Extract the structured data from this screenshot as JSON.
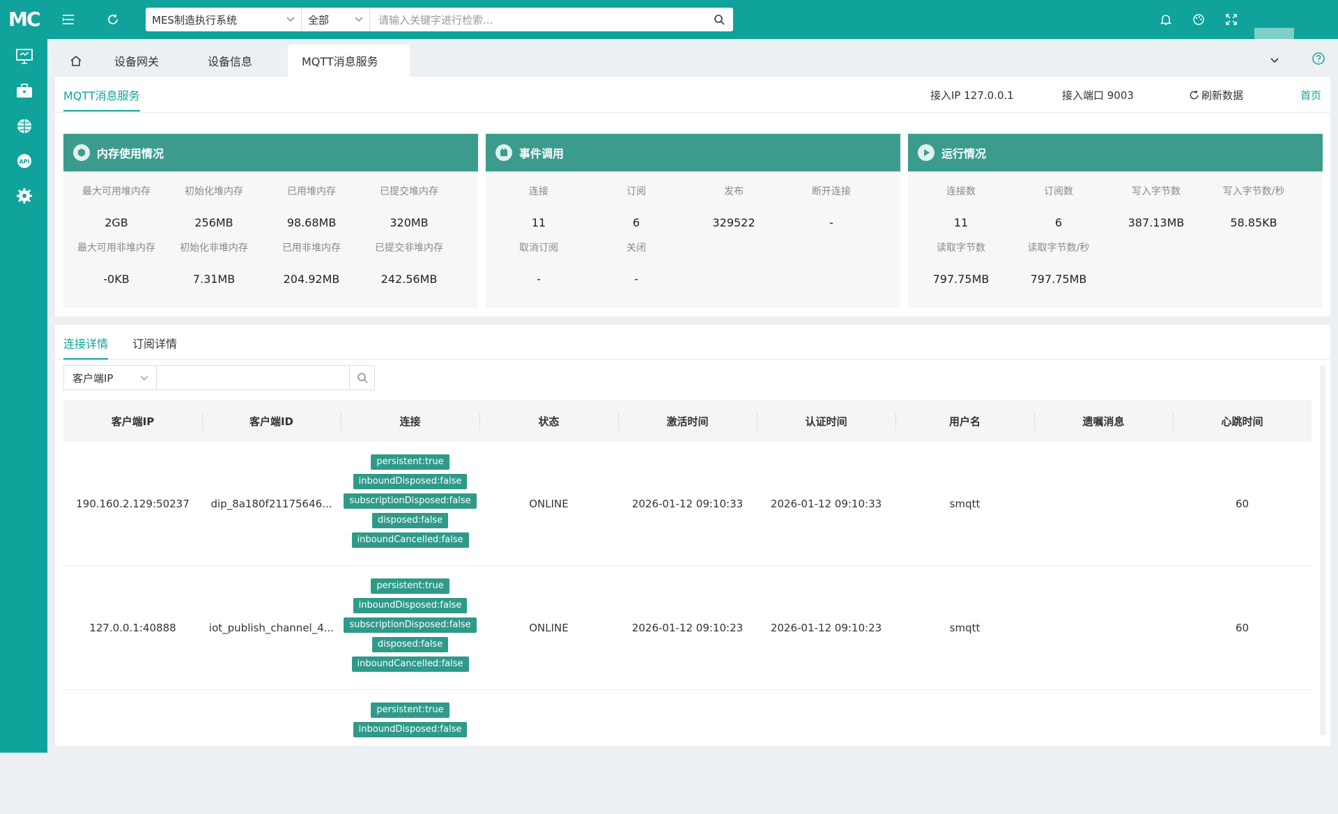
{
  "app": {
    "logo": "MC",
    "system_select": "MES制造执行系统",
    "scope_select": "全部",
    "search_placeholder": "请输入关键字进行检索..."
  },
  "tabs": [
    {
      "label": "设备网关"
    },
    {
      "label": "设备信息"
    },
    {
      "label": "MQTT消息服务"
    }
  ],
  "header": {
    "title": "MQTT消息服务",
    "ip": "接入IP 127.0.0.1",
    "port": "接入端口 9003",
    "refresh": "刷新数据",
    "home": "首页"
  },
  "cards": {
    "memory": {
      "title": "内存使用情况",
      "items": [
        {
          "label": "最大可用堆内存",
          "value": "2GB"
        },
        {
          "label": "初始化堆内存",
          "value": "256MB"
        },
        {
          "label": "已用堆内存",
          "value": "98.68MB"
        },
        {
          "label": "已提交堆内存",
          "value": "320MB"
        },
        {
          "label": "最大可用非堆内存",
          "value": "-0KB"
        },
        {
          "label": "初始化非堆内存",
          "value": "7.31MB"
        },
        {
          "label": "已用非堆内存",
          "value": "204.92MB"
        },
        {
          "label": "已提交非堆内存",
          "value": "242.56MB"
        }
      ]
    },
    "events": {
      "title": "事件调用",
      "items": [
        {
          "label": "连接",
          "value": "11"
        },
        {
          "label": "订阅",
          "value": "6"
        },
        {
          "label": "发布",
          "value": "329522"
        },
        {
          "label": "断开连接",
          "value": "-"
        },
        {
          "label": "取消订阅",
          "value": "-"
        },
        {
          "label": "关闭",
          "value": "-"
        }
      ]
    },
    "runtime": {
      "title": "运行情况",
      "items": [
        {
          "label": "连接数",
          "value": "11"
        },
        {
          "label": "订阅数",
          "value": "6"
        },
        {
          "label": "写入字节数",
          "value": "387.13MB"
        },
        {
          "label": "写入字节数/秒",
          "value": "58.85KB"
        },
        {
          "label": "读取字节数",
          "value": "797.75MB"
        },
        {
          "label": "读取字节数/秒",
          "value": "797.75MB"
        }
      ]
    }
  },
  "subtabs": {
    "connections": "连接详情",
    "subscriptions": "订阅详情"
  },
  "filter": {
    "field": "客户端IP"
  },
  "table": {
    "columns": [
      "客户端IP",
      "客户端ID",
      "连接",
      "状态",
      "激活时间",
      "认证时间",
      "用户名",
      "遗嘱消息",
      "心跳时间"
    ],
    "rows": [
      {
        "ip": "190.160.2.129:50237",
        "client_id": "dip_8a180f21175646...",
        "tags": [
          "persistent:true",
          "inboundDisposed:false",
          "subscriptionDisposed:false",
          "disposed:false",
          "inboundCancelled:false"
        ],
        "status": "ONLINE",
        "active_time": "2026-01-12 09:10:33",
        "auth_time": "2026-01-12 09:10:33",
        "username": "smqtt",
        "will": "",
        "heartbeat": "60"
      },
      {
        "ip": "127.0.0.1:40888",
        "client_id": "iot_publish_channel_4...",
        "tags": [
          "persistent:true",
          "inboundDisposed:false",
          "subscriptionDisposed:false",
          "disposed:false",
          "inboundCancelled:false"
        ],
        "status": "ONLINE",
        "active_time": "2026-01-12 09:10:23",
        "auth_time": "2026-01-12 09:10:23",
        "username": "smqtt",
        "will": "",
        "heartbeat": "60"
      },
      {
        "ip": "",
        "client_id": "",
        "tags": [
          "persistent:true",
          "inboundDisposed:false"
        ],
        "status": "",
        "active_time": "",
        "auth_time": "",
        "username": "",
        "will": "",
        "heartbeat": ""
      }
    ]
  }
}
